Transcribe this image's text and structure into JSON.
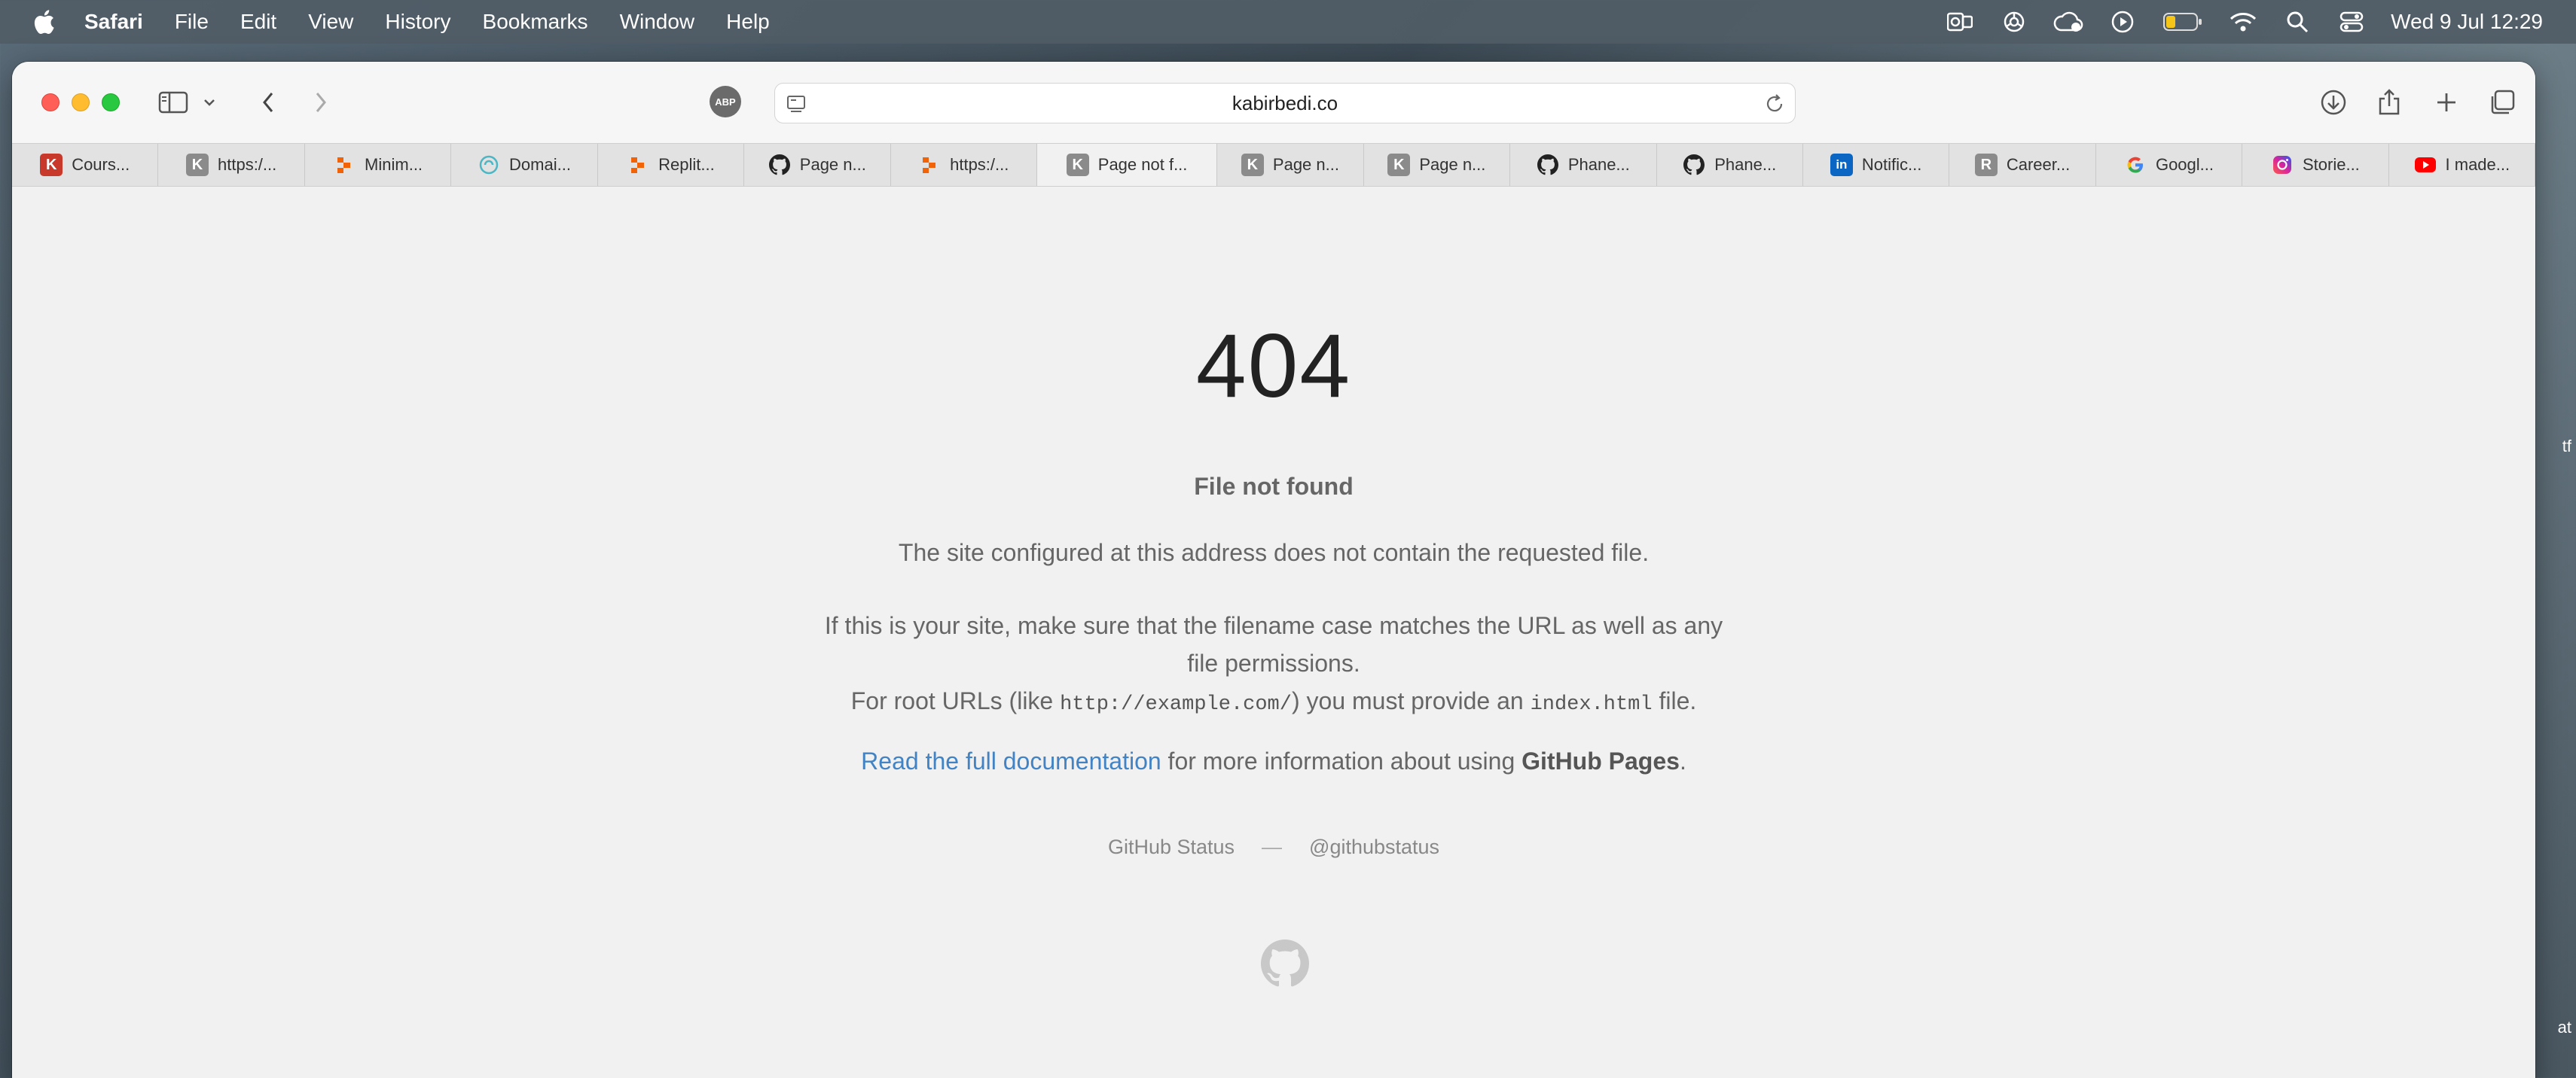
{
  "menubar": {
    "items": [
      "Safari",
      "File",
      "Edit",
      "View",
      "History",
      "Bookmarks",
      "Window",
      "Help"
    ],
    "clock": "Wed 9 Jul  12:29",
    "status_icons": [
      "outlook-icon",
      "chatgpt-icon",
      "creative-cloud-icon",
      "play-icon",
      "battery-icon",
      "wifi-icon",
      "spotlight-search-icon",
      "control-center-icon"
    ]
  },
  "desktop": {
    "edge_text_1": "tf",
    "edge_text_2": "at"
  },
  "toolbar": {
    "adblock_label": "ABP",
    "url": "kabirbedi.co"
  },
  "tabs": [
    {
      "label": "Cours...",
      "favicon": "K",
      "favicon_style": "k-red"
    },
    {
      "label": "https:/...",
      "favicon": "K",
      "favicon_style": "k-gray"
    },
    {
      "label": "Minim...",
      "favicon": "replit",
      "favicon_style": "replit"
    },
    {
      "label": "Domai...",
      "favicon": "domain",
      "favicon_style": "domain"
    },
    {
      "label": "Replit...",
      "favicon": "replit",
      "favicon_style": "replit"
    },
    {
      "label": "Page n...",
      "favicon": "github",
      "favicon_style": "github"
    },
    {
      "label": "https:/...",
      "favicon": "replit",
      "favicon_style": "replit"
    },
    {
      "label": "Page not f...",
      "favicon": "K",
      "favicon_style": "k-gray",
      "active": true
    },
    {
      "label": "Page n...",
      "favicon": "K",
      "favicon_style": "k-gray"
    },
    {
      "label": "Page n...",
      "favicon": "K",
      "favicon_style": "k-gray"
    },
    {
      "label": "Phane...",
      "favicon": "github",
      "favicon_style": "github"
    },
    {
      "label": "Phane...",
      "favicon": "github",
      "favicon_style": "github"
    },
    {
      "label": "Notific...",
      "favicon": "in",
      "favicon_style": "li"
    },
    {
      "label": "Career...",
      "favicon": "R",
      "favicon_style": "r-gray"
    },
    {
      "label": "Googl...",
      "favicon": "google",
      "favicon_style": "google"
    },
    {
      "label": "Storie...",
      "favicon": "instagram",
      "favicon_style": "instagram"
    },
    {
      "label": "I made...",
      "favicon": "youtube",
      "favicon_style": "youtube"
    }
  ],
  "page": {
    "code": "404",
    "heading": "File not found",
    "p1": "The site configured at this address does not contain the requested file.",
    "p2_line1": "If this is your site, make sure that the filename case matches the URL as well as any file permissions.",
    "p2_line2_a": "For root URLs (like ",
    "p2_code1": "http://example.com/",
    "p2_line2_b": ") you must provide an ",
    "p2_code2": "index.html",
    "p2_line2_c": " file.",
    "p3_link": "Read the full documentation",
    "p3_mid": " for more information about using ",
    "p3_bold": "GitHub Pages",
    "p3_end": ".",
    "footer_status": "GitHub Status",
    "footer_sep": "—",
    "footer_handle": "@githubstatus"
  }
}
